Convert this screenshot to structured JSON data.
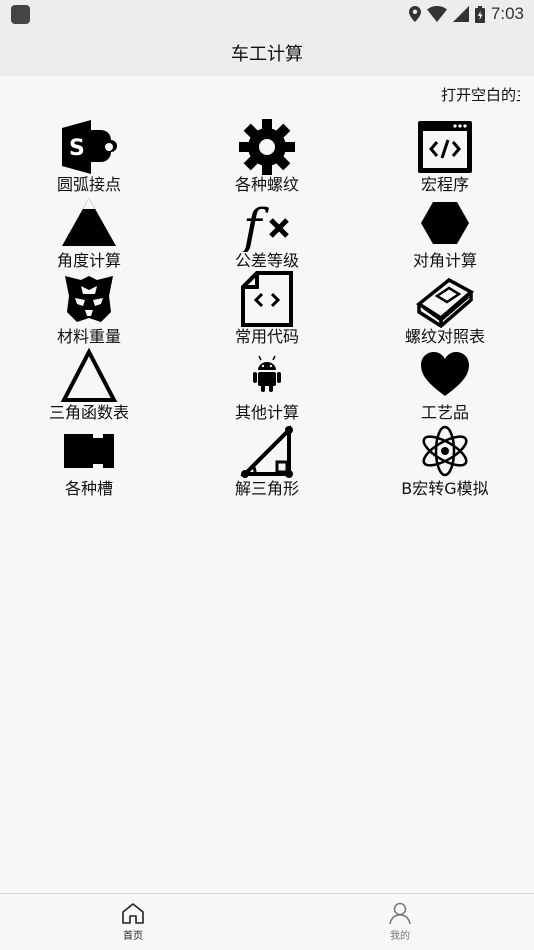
{
  "status": {
    "time": "7:03"
  },
  "appbar": {
    "title": "车工计算"
  },
  "marquee": {
    "text": "打开空白的主"
  },
  "grid": [
    {
      "label": "圆弧接点",
      "icon": "sharepoint-icon"
    },
    {
      "label": "各种螺纹",
      "icon": "gear-icon"
    },
    {
      "label": "宏程序",
      "icon": "code-window-icon"
    },
    {
      "label": "角度计算",
      "icon": "triangle-filled-icon"
    },
    {
      "label": "公差等级",
      "icon": "function-icon"
    },
    {
      "label": "对角计算",
      "icon": "hexagon-icon"
    },
    {
      "label": "材料重量",
      "icon": "transformer-icon"
    },
    {
      "label": "常用代码",
      "icon": "code-file-icon"
    },
    {
      "label": "螺纹对照表",
      "icon": "book-icon"
    },
    {
      "label": "三角函数表",
      "icon": "triangle-outline-icon"
    },
    {
      "label": "其他计算",
      "icon": "android-icon"
    },
    {
      "label": "工艺品",
      "icon": "heart-icon"
    },
    {
      "label": "各种槽",
      "icon": "slot-icon"
    },
    {
      "label": "解三角形",
      "icon": "right-triangle-icon"
    },
    {
      "label": "B宏转G模拟",
      "icon": "atom-icon"
    }
  ],
  "bottomnav": {
    "home": "首页",
    "mine": "我的"
  },
  "colors": {
    "bar": "#ededed",
    "background": "#f7f7f7",
    "icon": "#000000"
  }
}
